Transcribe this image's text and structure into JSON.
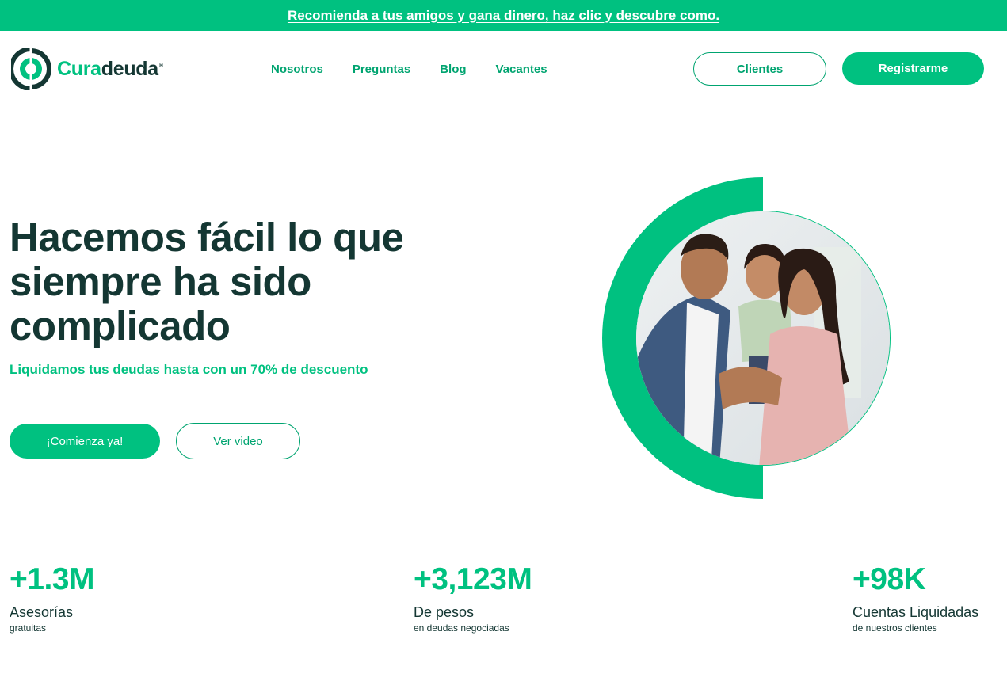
{
  "promo": {
    "text": "Recomienda a tus amigos y gana dinero, haz clic y descubre como."
  },
  "brand": {
    "name_part1": "Cura",
    "name_part2": "deuda",
    "mark": "®"
  },
  "nav": {
    "items": [
      {
        "label": "Nosotros"
      },
      {
        "label": "Preguntas"
      },
      {
        "label": "Blog"
      },
      {
        "label": "Vacantes"
      }
    ],
    "clientes_label": "Clientes",
    "registro_label": "Registrarme"
  },
  "hero": {
    "title_line1": "Hacemos fácil lo que",
    "title_line2": "siempre ha sido",
    "title_line3": "complicado",
    "subtitle": "Liquidamos tus deudas hasta con un 70% de descuento",
    "cta_primary": "¡Comienza ya!",
    "cta_secondary": "Ver video",
    "image_icon": "family-photo"
  },
  "stats": [
    {
      "value": "+1.3M",
      "label": "Asesorías",
      "sublabel": "gratuitas"
    },
    {
      "value": "+3,123M",
      "label": "De pesos",
      "sublabel": "en deudas negociadas"
    },
    {
      "value": "+98K",
      "label": "Cuentas Liquidadas",
      "sublabel": "de nuestros clientes"
    }
  ],
  "colors": {
    "brand_green": "#00c180",
    "link_green": "#00a470",
    "dark_text": "#143733"
  }
}
